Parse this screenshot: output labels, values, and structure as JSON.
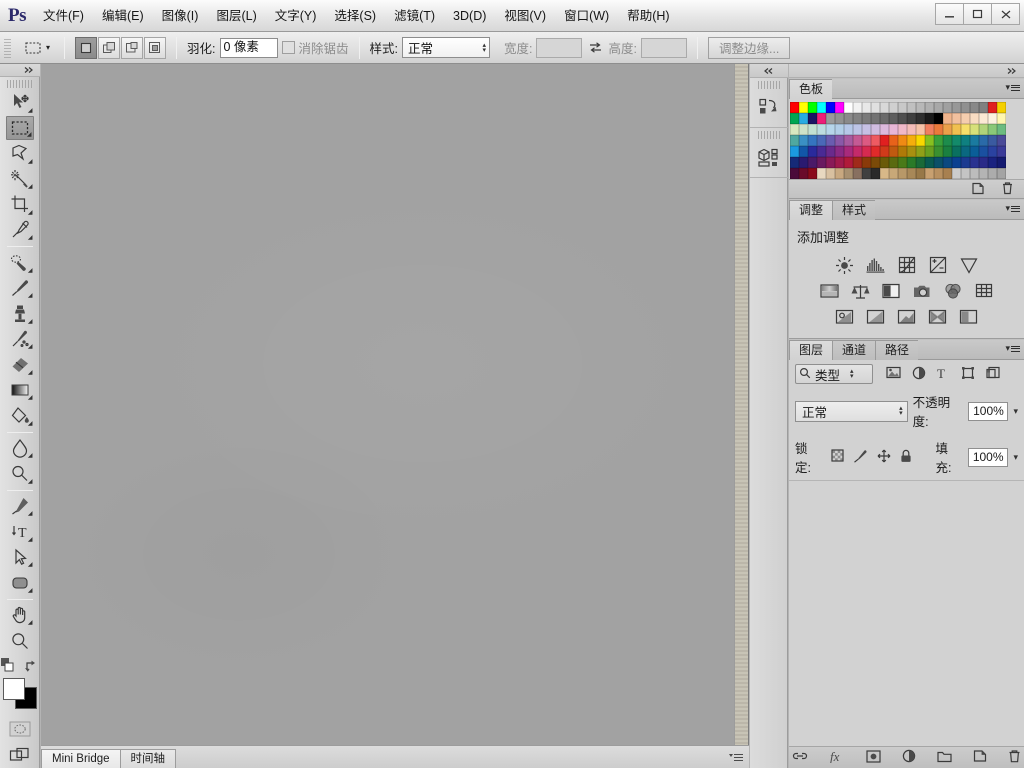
{
  "app": {
    "logo": "Ps",
    "menus": [
      {
        "label": "文件(F)",
        "name": "menu-file"
      },
      {
        "label": "编辑(E)",
        "name": "menu-edit"
      },
      {
        "label": "图像(I)",
        "name": "menu-image"
      },
      {
        "label": "图层(L)",
        "name": "menu-layer"
      },
      {
        "label": "文字(Y)",
        "name": "menu-type"
      },
      {
        "label": "选择(S)",
        "name": "menu-select"
      },
      {
        "label": "滤镜(T)",
        "name": "menu-filter"
      },
      {
        "label": "3D(D)",
        "name": "menu-3d"
      },
      {
        "label": "视图(V)",
        "name": "menu-view"
      },
      {
        "label": "窗口(W)",
        "name": "menu-window"
      },
      {
        "label": "帮助(H)",
        "name": "menu-help"
      }
    ],
    "window_controls": {
      "minimize": "minimize-icon",
      "maximize": "maximize-icon",
      "close": "close-icon"
    }
  },
  "options_bar": {
    "tool_icon": "rectangular-marquee-icon",
    "selection_modes": [
      {
        "name": "new-selection",
        "icon": "new-selection-icon",
        "active": true
      },
      {
        "name": "add-to-selection",
        "icon": "add-selection-icon",
        "active": false
      },
      {
        "name": "subtract-from-selection",
        "icon": "subtract-selection-icon",
        "active": false
      },
      {
        "name": "intersect-selection",
        "icon": "intersect-selection-icon",
        "active": false
      }
    ],
    "feather_label": "羽化:",
    "feather_value": "0 像素",
    "antialias_label": "消除锯齿",
    "antialias_checked": false,
    "style_label": "样式:",
    "style_value": "正常",
    "width_label": "宽度:",
    "width_value": "",
    "height_label": "高度:",
    "height_value": "",
    "swap_icon": "swap-dimensions-icon",
    "refine_edge_label": "调整边缘..."
  },
  "toolbar": {
    "collapse_icon": "collapse-right-icon",
    "tools": [
      {
        "name": "move-tool",
        "icon": "move-icon",
        "active": false,
        "has_submenu": true
      },
      {
        "name": "rectangular-marquee-tool",
        "icon": "marquee-icon",
        "active": true,
        "has_submenu": true
      },
      {
        "name": "lasso-tool",
        "icon": "lasso-icon",
        "active": false,
        "has_submenu": true
      },
      {
        "name": "magic-wand-tool",
        "icon": "magic-wand-icon",
        "active": false,
        "has_submenu": true
      },
      {
        "name": "crop-tool",
        "icon": "crop-icon",
        "active": false,
        "has_submenu": true
      },
      {
        "name": "eyedropper-tool",
        "icon": "eyedropper-icon",
        "active": false,
        "has_submenu": true
      },
      {
        "name": "spot-healing-tool",
        "icon": "healing-brush-icon",
        "active": false,
        "has_submenu": true
      },
      {
        "name": "brush-tool",
        "icon": "brush-icon",
        "active": false,
        "has_submenu": true
      },
      {
        "name": "clone-stamp-tool",
        "icon": "clone-stamp-icon",
        "active": false,
        "has_submenu": true
      },
      {
        "name": "history-brush-tool",
        "icon": "history-brush-icon",
        "active": false,
        "has_submenu": true
      },
      {
        "name": "eraser-tool",
        "icon": "eraser-icon",
        "active": false,
        "has_submenu": true
      },
      {
        "name": "gradient-tool",
        "icon": "gradient-icon",
        "active": false,
        "has_submenu": true
      },
      {
        "name": "paint-bucket-tool",
        "icon": "paint-bucket-icon",
        "active": false,
        "has_submenu": true
      },
      {
        "name": "blur-tool",
        "icon": "blur-droplet-icon",
        "active": false,
        "has_submenu": true
      },
      {
        "name": "dodge-tool",
        "icon": "dodge-icon",
        "active": false,
        "has_submenu": true
      },
      {
        "name": "pen-tool",
        "icon": "pen-icon",
        "active": false,
        "has_submenu": true
      },
      {
        "name": "type-tool",
        "icon": "type-t-icon",
        "active": false,
        "has_submenu": true
      },
      {
        "name": "path-selection-tool",
        "icon": "path-arrow-icon",
        "active": false,
        "has_submenu": true
      },
      {
        "name": "shape-tool",
        "icon": "rounded-rect-icon",
        "active": false,
        "has_submenu": true
      },
      {
        "name": "hand-tool",
        "icon": "hand-icon",
        "active": false,
        "has_submenu": true
      },
      {
        "name": "zoom-tool",
        "icon": "zoom-magnifier-icon",
        "active": false,
        "has_submenu": false
      }
    ],
    "default_colors_icon": "default-colors-icon",
    "swap_colors_icon": "swap-colors-icon",
    "foreground_color": "#ffffff",
    "background_color": "#000000",
    "quick_mask_icon": "quick-mask-icon",
    "screen_mode_icon": "screen-mode-icon"
  },
  "icon_dock": {
    "collapse_icon": "collapse-left-icon",
    "buttons": [
      {
        "name": "history-panel-icon",
        "icon": "history-icon"
      },
      {
        "name": "mini-bridge-panel-icon",
        "icon": "3d-box-icon"
      }
    ]
  },
  "panels": {
    "collapse_icon": "collapse-right-icon",
    "swatches": {
      "tabs": [
        {
          "label": "色板",
          "name": "tab-swatches",
          "active": true
        }
      ],
      "menu_icon": "panel-menu-icon",
      "new_swatch_icon": "new-swatch-icon",
      "delete_swatch_icon": "delete-swatch-icon",
      "colors": [
        "#ff0000",
        "#ffff00",
        "#00ff00",
        "#00ffff",
        "#0000ff",
        "#ff00ff",
        "#ffffff",
        "#f2f2f2",
        "#e8e8e8",
        "#e0e0e0",
        "#d8d8d8",
        "#d0d0d0",
        "#c8c8c8",
        "#c0c0c0",
        "#b8b8b8",
        "#b0b0b0",
        "#a8a8a8",
        "#a0a0a0",
        "#989898",
        "#909090",
        "#888888",
        "#808080",
        "#e02020",
        "#f5d000",
        "#00a651",
        "#29abe2",
        "#1b1464",
        "#ed1e79",
        "#9a9a9a",
        "#929292",
        "#8a8a8a",
        "#828282",
        "#7a7a7a",
        "#727272",
        "#6a6a6a",
        "#5e5e5e",
        "#4f4f4f",
        "#3f3f3f",
        "#2f2f2f",
        "#1a1a1a",
        "#000000",
        "#f0b48c",
        "#f2c09e",
        "#f5cdae",
        "#f8dcc2",
        "#fbe9d4",
        "#fdf2e0",
        "#fff7b0",
        "#d8e8c0",
        "#cde2c8",
        "#c2e0d2",
        "#bcdce0",
        "#b6d6ea",
        "#b2cfe8",
        "#b6c8e8",
        "#bdc4e6",
        "#c6c0e4",
        "#d0bce0",
        "#dcb8dc",
        "#e8b6d6",
        "#f0b8c8",
        "#f4bcb8",
        "#f6c2a8",
        "#f08060",
        "#ea7a3c",
        "#eba04a",
        "#f0c050",
        "#f6df6a",
        "#d6e07a",
        "#b0d47a",
        "#8ac878",
        "#6cbb80",
        "#4fa8a0",
        "#3a8fc4",
        "#3574c0",
        "#4a68b8",
        "#6a5cb0",
        "#8a58a8",
        "#a85aa0",
        "#c45a94",
        "#dc5a82",
        "#ee5a62",
        "#e02020",
        "#e8621a",
        "#ef8a14",
        "#f5ae0c",
        "#f8d800",
        "#86c020",
        "#3aa03a",
        "#1d8c4c",
        "#138a6a",
        "#0f8080",
        "#1a7aa0",
        "#2a6aa8",
        "#3a5aa0",
        "#4a4a98",
        "#1b9ae0",
        "#1256a8",
        "#2a2a9c",
        "#4a2a94",
        "#6a2a8c",
        "#8a2a84",
        "#a82a7c",
        "#c42a6a",
        "#d62a50",
        "#e02a2a",
        "#d03a1a",
        "#c05a10",
        "#b07a08",
        "#a89010",
        "#90a018",
        "#6aa020",
        "#3a9030",
        "#1a8040",
        "#0a7060",
        "#0a6880",
        "#0a5e98",
        "#1a50a0",
        "#2a42a0",
        "#3a3a98",
        "#152a78",
        "#2a1a70",
        "#4a1a68",
        "#6a1a60",
        "#8a1a58",
        "#a01a4c",
        "#b01a3a",
        "#a02a1a",
        "#8a3a0a",
        "#7a4a08",
        "#6a5a08",
        "#5a6a10",
        "#4a7a18",
        "#2a7a28",
        "#1a6a38",
        "#0a5a50",
        "#0a5068",
        "#0a4880",
        "#0a4090",
        "#1a3a90",
        "#2a3290",
        "#2a2a88",
        "#1a2280",
        "#141a70",
        "#4a0a3a",
        "#6a0a2a",
        "#8a0a1a",
        "#e8d8c0",
        "#d8c0a0",
        "#c8a880",
        "#a89070",
        "#887060",
        "#404040",
        "#2a2a2a",
        "#d8b888",
        "#c8a878",
        "#b89868",
        "#a88858",
        "#987848",
        "#c8a070",
        "#b89060",
        "#a88050",
        "#cccccc",
        "#c4c4c4",
        "#bcbcbc",
        "#b4b4b4",
        "#acacac",
        "#a4a4a4"
      ]
    },
    "adjustments": {
      "tabs": [
        {
          "label": "调整",
          "name": "tab-adjustments",
          "active": true
        },
        {
          "label": "样式",
          "name": "tab-styles",
          "active": false
        }
      ],
      "menu_icon": "panel-menu-icon",
      "title": "添加调整",
      "rows": [
        [
          {
            "name": "brightness-contrast-adjustment",
            "icon": "brightness-icon"
          },
          {
            "name": "levels-adjustment",
            "icon": "levels-icon"
          },
          {
            "name": "curves-adjustment",
            "icon": "curves-icon"
          },
          {
            "name": "exposure-adjustment",
            "icon": "exposure-icon"
          },
          {
            "name": "vibrance-adjustment",
            "icon": "vibrance-triangle-icon"
          }
        ],
        [
          {
            "name": "hue-saturation-adjustment",
            "icon": "hue-saturation-icon"
          },
          {
            "name": "color-balance-adjustment",
            "icon": "color-balance-scales-icon"
          },
          {
            "name": "black-white-adjustment",
            "icon": "black-white-icon"
          },
          {
            "name": "photo-filter-adjustment",
            "icon": "photo-filter-icon"
          },
          {
            "name": "channel-mixer-adjustment",
            "icon": "channel-mixer-icon"
          },
          {
            "name": "color-lookup-adjustment",
            "icon": "color-lookup-grid-icon"
          }
        ],
        [
          {
            "name": "invert-adjustment",
            "icon": "invert-icon"
          },
          {
            "name": "posterize-adjustment",
            "icon": "posterize-icon"
          },
          {
            "name": "threshold-adjustment",
            "icon": "threshold-icon"
          },
          {
            "name": "gradient-map-adjustment",
            "icon": "gradient-map-icon"
          },
          {
            "name": "selective-color-adjustment",
            "icon": "selective-color-icon"
          }
        ]
      ]
    },
    "layers": {
      "tabs": [
        {
          "label": "图层",
          "name": "tab-layers",
          "active": true
        },
        {
          "label": "通道",
          "name": "tab-channels",
          "active": false
        },
        {
          "label": "路径",
          "name": "tab-paths",
          "active": false
        }
      ],
      "menu_icon": "panel-menu-icon",
      "filter_search_icon": "search-icon",
      "filter_type_value": "类型",
      "filter_icons": [
        {
          "name": "filter-pixel-layers",
          "icon": "image-icon"
        },
        {
          "name": "filter-adjustment-layers",
          "icon": "adjustment-circle-icon"
        },
        {
          "name": "filter-type-layers",
          "icon": "type-t-icon"
        },
        {
          "name": "filter-shape-layers",
          "icon": "shape-bounds-icon"
        },
        {
          "name": "filter-smart-objects",
          "icon": "smart-object-icon"
        }
      ],
      "blend_mode": "正常",
      "opacity_label": "不透明度:",
      "opacity_value": "100%",
      "lock_label": "锁定:",
      "lock_icons": [
        {
          "name": "lock-transparent-pixels",
          "icon": "checkerboard-icon"
        },
        {
          "name": "lock-image-pixels",
          "icon": "brush-icon"
        },
        {
          "name": "lock-position",
          "icon": "move-cross-icon"
        },
        {
          "name": "lock-all",
          "icon": "padlock-icon"
        }
      ],
      "fill_label": "填充:",
      "fill_value": "100%",
      "footer_icons": [
        {
          "name": "link-layers-button",
          "icon": "link-icon"
        },
        {
          "name": "layer-style-button",
          "icon": "fx-icon"
        },
        {
          "name": "layer-mask-button",
          "icon": "mask-icon"
        },
        {
          "name": "new-adjustment-layer-button",
          "icon": "adjustment-circle-icon"
        },
        {
          "name": "new-group-button",
          "icon": "folder-icon"
        },
        {
          "name": "new-layer-button",
          "icon": "new-layer-icon"
        },
        {
          "name": "delete-layer-button",
          "icon": "trash-icon"
        }
      ]
    }
  },
  "status_bar": {
    "tabs": [
      {
        "label": "Mini Bridge",
        "name": "tab-mini-bridge",
        "active": true
      },
      {
        "label": "时间轴",
        "name": "tab-timeline",
        "active": false
      }
    ],
    "menu_icon": "panel-menu-icon"
  }
}
